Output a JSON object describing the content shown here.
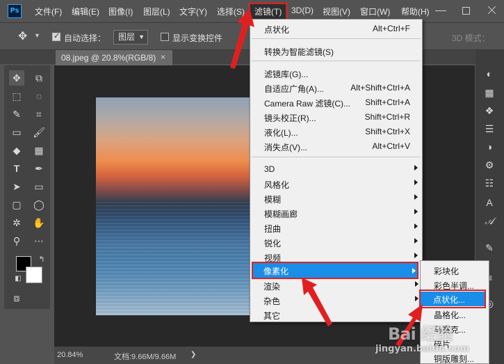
{
  "app": {
    "logo": "Ps"
  },
  "menubar": {
    "items": [
      {
        "label": "文件(F)"
      },
      {
        "label": "编辑(E)"
      },
      {
        "label": "图像(I)"
      },
      {
        "label": "图层(L)"
      },
      {
        "label": "文字(Y)"
      },
      {
        "label": "选择(S)"
      },
      {
        "label": "滤镜(T)"
      },
      {
        "label": "3D(D)"
      },
      {
        "label": "视图(V)"
      },
      {
        "label": "窗口(W)"
      },
      {
        "label": "帮助(H)"
      }
    ]
  },
  "options": {
    "auto_select_label": "自动选择：",
    "layer_select_value": "图层",
    "show_transform_label": "显示变换控件",
    "mode_3d_label": "3D 模式："
  },
  "document": {
    "tab_title": "08.jpeg @ 20.8%(RGB/8)",
    "close_glyph": "×"
  },
  "filter_menu": {
    "items": [
      {
        "label": "点状化",
        "shortcut": "Alt+Ctrl+F"
      },
      {
        "label": "转换为智能滤镜(S)",
        "shortcut": ""
      },
      {
        "label": "滤镜库(G)...",
        "shortcut": ""
      },
      {
        "label": "自适应广角(A)...",
        "shortcut": "Alt+Shift+Ctrl+A"
      },
      {
        "label": "Camera Raw 滤镜(C)...",
        "shortcut": "Shift+Ctrl+A"
      },
      {
        "label": "镜头校正(R)...",
        "shortcut": "Shift+Ctrl+R"
      },
      {
        "label": "液化(L)...",
        "shortcut": "Shift+Ctrl+X"
      },
      {
        "label": "消失点(V)...",
        "shortcut": "Alt+Ctrl+V"
      },
      {
        "label": "3D"
      },
      {
        "label": "风格化"
      },
      {
        "label": "模糊"
      },
      {
        "label": "模糊画廊"
      },
      {
        "label": "扭曲"
      },
      {
        "label": "锐化"
      },
      {
        "label": "视频"
      },
      {
        "label": "像素化"
      },
      {
        "label": "渲染"
      },
      {
        "label": "杂色"
      },
      {
        "label": "其它"
      }
    ]
  },
  "pixelate_submenu": {
    "items": [
      {
        "label": "彩块化"
      },
      {
        "label": "彩色半调..."
      },
      {
        "label": "点状化..."
      },
      {
        "label": "晶格化..."
      },
      {
        "label": "马赛克..."
      },
      {
        "label": "碎片"
      },
      {
        "label": "铜版雕刻..."
      }
    ]
  },
  "status": {
    "zoom": "20.84%",
    "doc_size": "文档:9.66M/9.66M"
  },
  "watermark": {
    "logo_text": "Bai 经验",
    "url": "jingyan.baidu.com"
  },
  "colors": {
    "highlight": "#1a8de8",
    "annotation_red": "#e02020",
    "ps_blue": "#31a8ff"
  }
}
